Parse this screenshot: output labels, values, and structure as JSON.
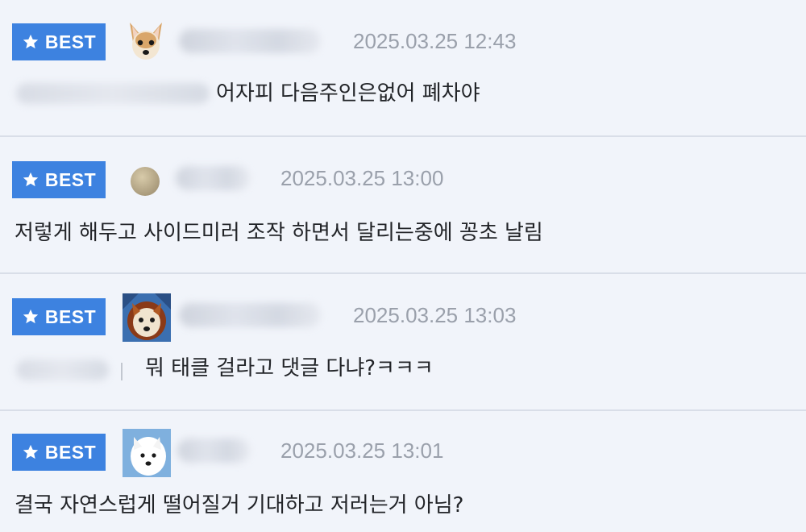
{
  "badge_label": "BEST",
  "comments": [
    {
      "date": "2025.03.25 12:43",
      "text": "어자피 다음주인은없어 폐차야"
    },
    {
      "date": "2025.03.25 13:00",
      "text": "저렇게 해두고 사이드미러 조작 하면서 달리는중에 꽁초 날림"
    },
    {
      "date": "2025.03.25 13:03",
      "text": "뭐 태클 걸라고 댓글 다냐?ㅋㅋㅋ"
    },
    {
      "date": "2025.03.25 13:01",
      "text": "결국 자연스럽게 떨어질거 기대하고 저러는거 아님?"
    }
  ],
  "colors": {
    "badge": "#3d82e0",
    "background": "#f1f4fa",
    "date": "#9aa0ab",
    "text": "#222428"
  },
  "icons": {
    "badge": "star-icon"
  }
}
